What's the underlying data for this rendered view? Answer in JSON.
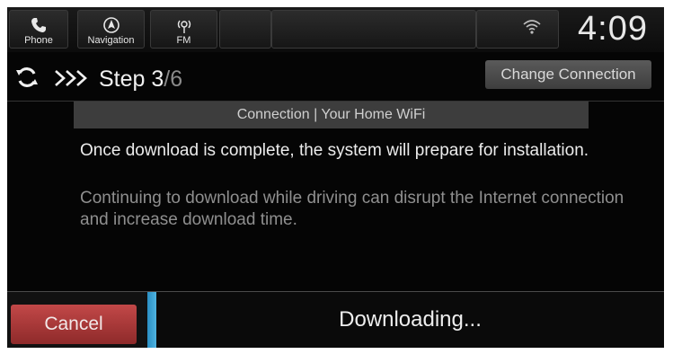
{
  "status_bar": {
    "tabs": [
      {
        "label": "Phone",
        "icon": "phone-icon"
      },
      {
        "label": "Navigation",
        "icon": "navigation-icon"
      },
      {
        "label": "FM",
        "icon": "radio-icon"
      }
    ],
    "clock": "4:09",
    "signal_icon": "wifi-signal-icon"
  },
  "step": {
    "prefix": "Step ",
    "current": "3",
    "total": "/6",
    "refresh_icon": "refresh-icon",
    "progress_icon": "chevrons-icon"
  },
  "change_connection_label": "Change Connection",
  "connection_banner": "Connection | Your Home WiFi",
  "messages": {
    "main": "Once download is complete, the system will prepare for installation.",
    "sub": "Continuing to download while driving can disrupt the Internet connection and increase download time."
  },
  "bottom": {
    "cancel_label": "Cancel",
    "status": "Downloading..."
  },
  "colors": {
    "accent_blue": "#2a8fc4",
    "cancel_red": "#b23c3c",
    "background": "#050505"
  }
}
